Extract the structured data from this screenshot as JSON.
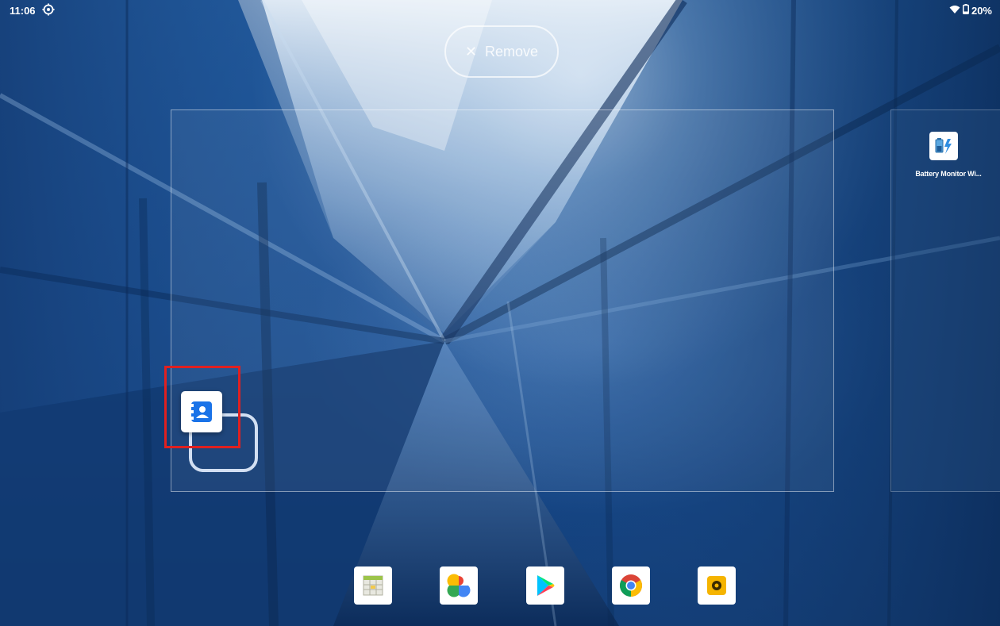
{
  "status_bar": {
    "time": "11:06",
    "battery_text": "20%",
    "icons": [
      "settings-gear-icon",
      "wifi-icon",
      "battery-icon"
    ]
  },
  "remove_target": {
    "icon": "close-icon",
    "label": "Remove"
  },
  "next_page_apps": [
    {
      "name": "Battery Monitor Wi...",
      "icon": "battery-monitor-icon"
    }
  ],
  "dragged_app": {
    "icon": "contacts-icon",
    "color": "#1a73e8"
  },
  "dock": [
    {
      "icon": "sheets-app-icon"
    },
    {
      "icon": "google-photos-icon"
    },
    {
      "icon": "google-play-icon"
    },
    {
      "icon": "chrome-icon"
    },
    {
      "icon": "camera-app-icon"
    }
  ],
  "colors": {
    "highlight": "#e02020",
    "accent": "#1a73e8"
  }
}
